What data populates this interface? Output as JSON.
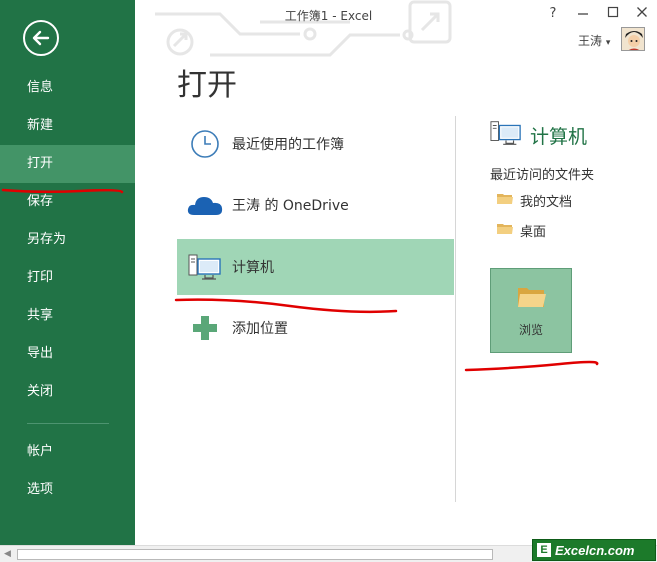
{
  "window": {
    "title": "工作簿1 - Excel",
    "help_label": "?",
    "user_name": "王涛",
    "user_dropdown": "▾"
  },
  "sidebar": {
    "items": [
      {
        "label": "信息"
      },
      {
        "label": "新建"
      },
      {
        "label": "打开"
      },
      {
        "label": "保存"
      },
      {
        "label": "另存为"
      },
      {
        "label": "打印"
      },
      {
        "label": "共享"
      },
      {
        "label": "导出"
      },
      {
        "label": "关闭"
      }
    ],
    "bottom_items": [
      {
        "label": "帐户"
      },
      {
        "label": "选项"
      }
    ],
    "active_index": 2
  },
  "main": {
    "title": "打开",
    "locations": [
      {
        "label": "最近使用的工作簿",
        "icon": "clock-icon"
      },
      {
        "label": "王涛 的 OneDrive",
        "icon": "cloud-icon"
      },
      {
        "label": "计算机",
        "icon": "computer-icon",
        "selected": true
      },
      {
        "label": "添加位置",
        "icon": "plus-icon"
      }
    ]
  },
  "right_panel": {
    "title": "计算机",
    "recent_heading": "最近访问的文件夹",
    "folders": [
      {
        "label": "我的文档"
      },
      {
        "label": "桌面"
      }
    ],
    "browse_label": "浏览"
  },
  "watermark": {
    "logo_letter": "E",
    "text": "Excelcn.com"
  },
  "colors": {
    "sidebar": "#217346",
    "sidebar_active": "#439467",
    "selected_location": "#a0d6b6",
    "annotation": "#e00000"
  }
}
